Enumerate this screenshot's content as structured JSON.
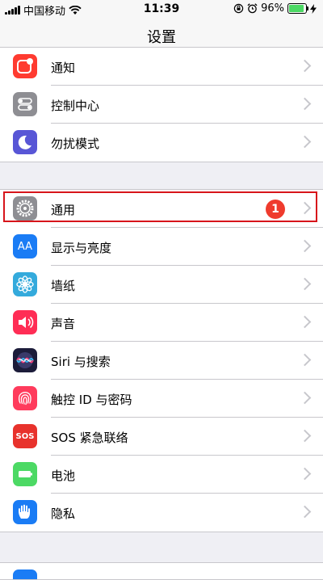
{
  "status_bar": {
    "carrier": "中国移动",
    "time": "11:39",
    "battery_percent": "96%",
    "battery_level": 0.96,
    "colors": {
      "battery_fill": "#4cd964"
    }
  },
  "nav": {
    "title": "设置"
  },
  "groups": [
    {
      "items": [
        {
          "label": "通知",
          "icon": "notifications-icon",
          "icon_color": "#ff3b30"
        },
        {
          "label": "控制中心",
          "icon": "control-center-icon",
          "icon_color": "#8e8e93"
        },
        {
          "label": "勿扰模式",
          "icon": "do-not-disturb-moon-icon",
          "icon_color": "#5856d6"
        }
      ]
    },
    {
      "items": [
        {
          "label": "通用",
          "icon": "gear-icon",
          "icon_color": "#8e8e93",
          "badge": "1"
        },
        {
          "label": "显示与亮度",
          "icon": "display-brightness-icon",
          "icon_color": "#1a7cf5",
          "icon_text": "AA"
        },
        {
          "label": "墙纸",
          "icon": "wallpaper-flower-icon",
          "icon_color": "#34aadc"
        },
        {
          "label": "声音",
          "icon": "sound-speaker-icon",
          "icon_color": "#ff2d55"
        },
        {
          "label": "Siri 与搜索",
          "icon": "siri-icon",
          "icon_color": "#1c1c3a"
        },
        {
          "label": "触控 ID 与密码",
          "icon": "fingerprint-icon",
          "icon_color": "#ff3b5c"
        },
        {
          "label": "SOS 紧急联络",
          "icon": "sos-icon",
          "icon_color": "#e8322c",
          "icon_text": "SOS"
        },
        {
          "label": "电池",
          "icon": "battery-icon",
          "icon_color": "#4cd964"
        },
        {
          "label": "隐私",
          "icon": "privacy-hand-icon",
          "icon_color": "#1a7cf5"
        }
      ]
    }
  ],
  "colors": {
    "highlight_border": "#d7151b",
    "badge": "#ef3b2d",
    "background": "#efeff4"
  }
}
